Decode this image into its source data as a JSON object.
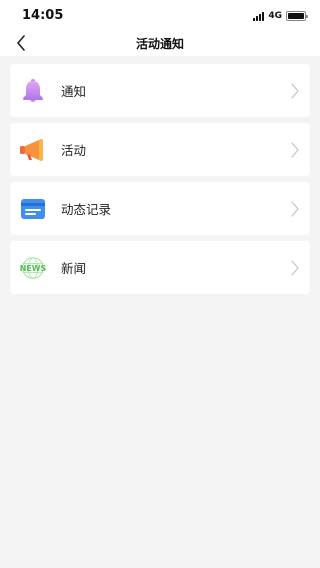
{
  "status_bar": {
    "time": "14:05",
    "network": "4G"
  },
  "nav": {
    "title": "活动通知",
    "back_icon": "chevron-left-icon"
  },
  "menu": {
    "items": [
      {
        "label": "通知",
        "icon": "bell-icon",
        "color": "#c58cf0"
      },
      {
        "label": "活动",
        "icon": "megaphone-icon",
        "color": "#f5823a"
      },
      {
        "label": "动态记录",
        "icon": "card-icon",
        "color": "#3f8ef0"
      },
      {
        "label": "新闻",
        "icon": "news-icon",
        "icon_text": "NEWS",
        "color": "#6cd06c"
      }
    ],
    "chevron_icon": "chevron-right-icon"
  },
  "colors": {
    "background": "#f4f4f4",
    "card": "#ffffff",
    "chevron": "#c4c4c4"
  }
}
